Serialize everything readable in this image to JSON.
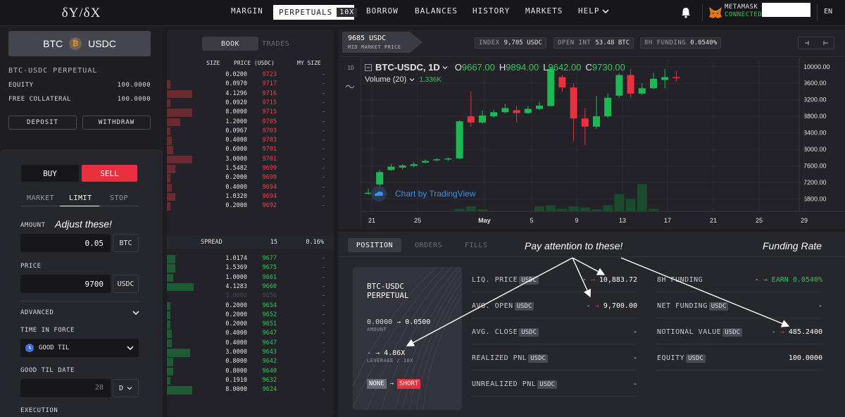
{
  "logo": "δY/δX",
  "nav": {
    "margin": "MARGIN",
    "perpetuals": "PERPETUALS",
    "perpetuals_leverage": "10X",
    "borrow": "BORROW",
    "balances": "BALANCES",
    "history": "HISTORY",
    "markets": "MARKETS",
    "help": "HELP",
    "wallet_name": "METAMASK",
    "wallet_status": "CONNECTED",
    "language": "EN"
  },
  "account": {
    "pair_base": "BTC",
    "pair_quote": "USDC",
    "market_label": "BTC-USDC PERPETUAL",
    "equity_label": "EQUITY",
    "equity_value": "100.0000",
    "free_collateral_label": "FREE COLLATERAL",
    "free_collateral_value": "100.0000",
    "deposit": "DEPOSIT",
    "withdraw": "WITHDRAW"
  },
  "order_form": {
    "buy": "BUY",
    "sell": "SELL",
    "tabs": [
      "MARKET",
      "LIMIT",
      "STOP"
    ],
    "amount_label": "AMOUNT",
    "amount_value": "0.05",
    "amount_unit": "BTC",
    "amount_note": "Adjust these!",
    "price_label": "PRICE",
    "price_value": "9700",
    "price_unit": "USDC",
    "advanced_label": "ADVANCED",
    "time_in_force_label": "TIME IN FORCE",
    "time_in_force_value": "GOOD TIL",
    "good_til_date_label": "GOOD TIL DATE",
    "good_til_date_value": "28",
    "good_til_date_unit": "D",
    "execution_label": "EXECUTION"
  },
  "order_book": {
    "tab_book": "BOOK",
    "tab_trades": "TRADES",
    "col_size": "SIZE",
    "col_price": "PRICE (USDC)",
    "col_my_size": "MY SIZE",
    "asks": [
      {
        "size": "0.0200",
        "price": "9723",
        "my": "-",
        "depth": 0.0
      },
      {
        "size": "0.0970",
        "price": "9717",
        "my": "-",
        "depth": 0.02
      },
      {
        "size": "4.1296",
        "price": "9716",
        "my": "-",
        "depth": 0.15
      },
      {
        "size": "0.0920",
        "price": "9715",
        "my": "-",
        "depth": 0.02
      },
      {
        "size": "8.0000",
        "price": "9715",
        "my": "-",
        "depth": 0.15
      },
      {
        "size": "1.2000",
        "price": "9705",
        "my": "-",
        "depth": 0.08
      },
      {
        "size": "0.0967",
        "price": "9703",
        "my": "-",
        "depth": 0.02
      },
      {
        "size": "0.4000",
        "price": "9703",
        "my": "-",
        "depth": 0.03
      },
      {
        "size": "0.6000",
        "price": "9701",
        "my": "-",
        "depth": 0.04
      },
      {
        "size": "3.0000",
        "price": "9701",
        "my": "-",
        "depth": 0.15
      },
      {
        "size": "1.5482",
        "price": "9699",
        "my": "-",
        "depth": 0.05
      },
      {
        "size": "0.2000",
        "price": "9698",
        "my": "-",
        "depth": 0.02
      },
      {
        "size": "0.4000",
        "price": "9694",
        "my": "-",
        "depth": 0.03
      },
      {
        "size": "1.0320",
        "price": "9694",
        "my": "-",
        "depth": 0.05
      },
      {
        "size": "0.2000",
        "price": "9692",
        "my": "-",
        "depth": 0.02
      }
    ],
    "spread_label": "SPREAD",
    "spread_value": "15",
    "spread_pct": "0.16%",
    "bids": [
      {
        "size": "1.0174",
        "price": "9677",
        "my": "-",
        "depth": 0.05
      },
      {
        "size": "1.5369",
        "price": "9675",
        "my": "-",
        "depth": 0.05
      },
      {
        "size": "1.0000",
        "price": "9661",
        "my": "-",
        "depth": 0.04
      },
      {
        "size": "4.1283",
        "price": "9660",
        "my": "-",
        "depth": 0.16
      },
      {
        "size": "1.0000",
        "price": "9656",
        "my": "-",
        "depth": 0.0,
        "dim": true
      },
      {
        "size": "0.2000",
        "price": "9654",
        "my": "-",
        "depth": 0.02
      },
      {
        "size": "0.2000",
        "price": "9652",
        "my": "-",
        "depth": 0.02
      },
      {
        "size": "0.2000",
        "price": "9651",
        "my": "-",
        "depth": 0.02
      },
      {
        "size": "0.4000",
        "price": "9647",
        "my": "-",
        "depth": 0.03
      },
      {
        "size": "0.4000",
        "price": "9647",
        "my": "-",
        "depth": 0.03
      },
      {
        "size": "3.0000",
        "price": "9643",
        "my": "-",
        "depth": 0.14
      },
      {
        "size": "0.8000",
        "price": "9642",
        "my": "-",
        "depth": 0.04
      },
      {
        "size": "0.8000",
        "price": "9640",
        "my": "-",
        "depth": 0.04
      },
      {
        "size": "0.1910",
        "price": "9632",
        "my": "-",
        "depth": 0.02
      },
      {
        "size": "8.0000",
        "price": "9624",
        "my": "-",
        "depth": 0.15
      }
    ]
  },
  "market_header": {
    "mid_price": "9685 USDC",
    "mid_label": "MID MARKET PRICE",
    "index_label": "INDEX",
    "index_value": "9,705 USDC",
    "open_int_label": "OPEN INT",
    "open_int_value": "53.48 BTC",
    "funding_label": "8H FUNDING",
    "funding_value": "0.0540%"
  },
  "chart": {
    "interval": "1D",
    "symbol": "BTC-USDC, 1D",
    "ohlc": {
      "o": "9667.00",
      "h": "9894.00",
      "l": "9642.00",
      "c": "9730.00"
    },
    "volume_label": "Volume (20)",
    "volume_value": "1.336K",
    "attribution": "Chart by TradingView",
    "colors": {
      "up": "#1db954",
      "down": "#e8303f"
    }
  },
  "chart_data": {
    "type": "candlestick",
    "title": "BTC-USDC, 1D",
    "ylim": [
      6500,
      10150
    ],
    "yticks": [
      "10000.00",
      "9600.00",
      "9200.00",
      "8800.00",
      "8400.00",
      "8000.00",
      "7600.00",
      "7200.00",
      "6800.00"
    ],
    "xticks": [
      "21",
      "25",
      "May",
      "5",
      "9",
      "13",
      "17",
      "21",
      "25",
      "29"
    ],
    "candles": [
      {
        "o": 6950,
        "h": 7050,
        "l": 6900,
        "c": 6950
      },
      {
        "o": 7150,
        "h": 7500,
        "l": 7100,
        "c": 7450
      },
      {
        "o": 7500,
        "h": 7650,
        "l": 7480,
        "c": 7580
      },
      {
        "o": 7560,
        "h": 7640,
        "l": 7520,
        "c": 7610
      },
      {
        "o": 7600,
        "h": 7700,
        "l": 7560,
        "c": 7640
      },
      {
        "o": 7680,
        "h": 7760,
        "l": 7660,
        "c": 7720
      },
      {
        "o": 7740,
        "h": 7790,
        "l": 7700,
        "c": 7760
      },
      {
        "o": 7760,
        "h": 7800,
        "l": 7720,
        "c": 7780
      },
      {
        "o": 7780,
        "h": 8700,
        "l": 7770,
        "c": 8680
      },
      {
        "o": 8800,
        "h": 9400,
        "l": 8550,
        "c": 8650
      },
      {
        "o": 8650,
        "h": 8950,
        "l": 8620,
        "c": 8820
      },
      {
        "o": 8800,
        "h": 8950,
        "l": 8770,
        "c": 8900
      },
      {
        "o": 8900,
        "h": 9100,
        "l": 8880,
        "c": 9000
      },
      {
        "o": 8950,
        "h": 9050,
        "l": 8650,
        "c": 8880
      },
      {
        "o": 8880,
        "h": 9050,
        "l": 8860,
        "c": 8980
      },
      {
        "o": 8980,
        "h": 9150,
        "l": 8950,
        "c": 9060
      },
      {
        "o": 9050,
        "h": 10000,
        "l": 9040,
        "c": 9950
      },
      {
        "o": 9750,
        "h": 9800,
        "l": 9400,
        "c": 9500
      },
      {
        "o": 9500,
        "h": 9600,
        "l": 8200,
        "c": 8750
      },
      {
        "o": 8750,
        "h": 9000,
        "l": 8100,
        "c": 8550
      },
      {
        "o": 8550,
        "h": 9300,
        "l": 8500,
        "c": 8800
      },
      {
        "o": 8800,
        "h": 9350,
        "l": 8760,
        "c": 9250
      },
      {
        "o": 9300,
        "h": 9850,
        "l": 9250,
        "c": 9800
      },
      {
        "o": 9800,
        "h": 9950,
        "l": 9250,
        "c": 9350
      },
      {
        "o": 9350,
        "h": 9600,
        "l": 9320,
        "c": 9480
      },
      {
        "o": 9480,
        "h": 9850,
        "l": 9460,
        "c": 9710
      },
      {
        "o": 9680,
        "h": 9950,
        "l": 9480,
        "c": 9750
      },
      {
        "o": 9750,
        "h": 9894,
        "l": 9642,
        "c": 9730
      }
    ],
    "volume": [
      0,
      0,
      0,
      0,
      0,
      0,
      0,
      0,
      0.05,
      0.1,
      0.04,
      0,
      0,
      0,
      0,
      0.1,
      0.12,
      0.05,
      0.1,
      0.08,
      0.04,
      0.12,
      0.35,
      0.25,
      0.55,
      0.05,
      0,
      0
    ]
  },
  "positions": {
    "tab_position": "POSITION",
    "tab_orders": "ORDERS",
    "tab_fills": "FILLS",
    "note_attention": "Pay attention to these!",
    "note_funding": "Funding Rate",
    "card_title_1": "BTC-USDC",
    "card_title_2": "PERPETUAL",
    "amount_from": "0.0000",
    "amount_to": "0.0500",
    "amount_label": "AMOUNT",
    "leverage_from": "-",
    "leverage_to": "4.86X",
    "leverage_label": "LEVERAGE / 10X",
    "side_from": "NONE",
    "side_to": "SHORT",
    "stats_left": [
      {
        "label": "LIQ. PRICE",
        "unit": "USDC",
        "from": "-",
        "to": "10,883.72"
      },
      {
        "label": "AVG. OPEN",
        "unit": "USDC",
        "from": "-",
        "to": "9,700.00"
      },
      {
        "label": "AVG. CLOSE",
        "unit": "USDC",
        "value": "-"
      },
      {
        "label": "REALIZED PNL",
        "unit": "USDC",
        "value": "-"
      },
      {
        "label": "UNREALIZED PNL",
        "unit": "USDC",
        "value": "-"
      }
    ],
    "stats_right": [
      {
        "label": "8H FUNDING",
        "unit": "",
        "from": "-",
        "to": "EARN 0.0540%"
      },
      {
        "label": "NET FUNDING",
        "unit": "USDC",
        "value": "-"
      },
      {
        "label": "NOTIONAL VALUE",
        "unit": "USDC",
        "from": "-",
        "to": "485.2400"
      },
      {
        "label": "EQUITY",
        "unit": "USDC",
        "value": "100.0000"
      }
    ]
  }
}
